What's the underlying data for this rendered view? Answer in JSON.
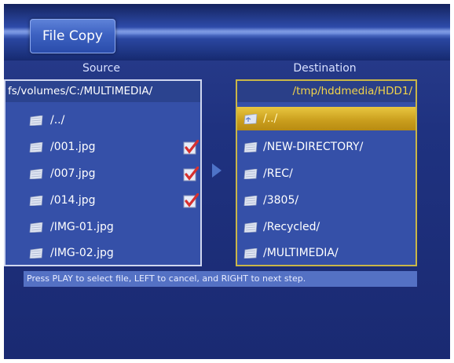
{
  "header": {
    "title": "File Copy"
  },
  "source": {
    "label": "Source",
    "path": "fs/volumes/C:/MULTIMEDIA/",
    "items": [
      {
        "name": "/../",
        "checked": false
      },
      {
        "name": "/001.jpg",
        "checked": true
      },
      {
        "name": "/007.jpg",
        "checked": true
      },
      {
        "name": "/014.jpg",
        "checked": true
      },
      {
        "name": "/IMG-01.jpg",
        "checked": false
      },
      {
        "name": "/IMG-02.jpg",
        "checked": false
      }
    ]
  },
  "destination": {
    "label": "Destination",
    "path": "/tmp/hddmedia/HDD1/",
    "items": [
      {
        "name": "/../",
        "selected": true
      },
      {
        "name": "/NEW-DIRECTORY/"
      },
      {
        "name": "/REC/"
      },
      {
        "name": "/3805/"
      },
      {
        "name": "/Recycled/"
      },
      {
        "name": "/MULTIMEDIA/"
      }
    ]
  },
  "status": {
    "text": "Press PLAY to select file, LEFT to cancel, and RIGHT to next step."
  },
  "colors": {
    "accent_selected": "#e0b830",
    "check": "#d63030",
    "panel": "#3550a8"
  },
  "icons": {
    "file": "file-icon",
    "check": "checkmark-icon",
    "arrow": "right-arrow-icon"
  }
}
